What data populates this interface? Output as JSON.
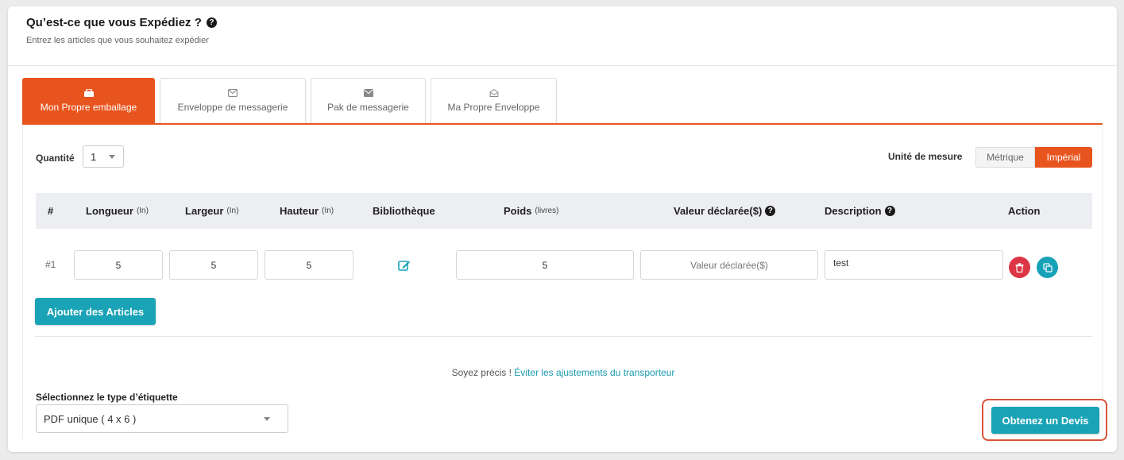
{
  "header": {
    "title": "Qu’est-ce que vous Expédiez ?",
    "subtitle": "Entrez les articles que vous souhaitez expédier"
  },
  "tabs": [
    {
      "label": "Mon Propre emballage",
      "icon": "package-icon",
      "active": true
    },
    {
      "label": "Enveloppe de messagerie",
      "icon": "envelope-outline-icon",
      "active": false
    },
    {
      "label": "Pak de messagerie",
      "icon": "envelope-solid-icon",
      "active": false
    },
    {
      "label": "Ma Propre Enveloppe",
      "icon": "envelope-open-icon",
      "active": false
    }
  ],
  "quantity": {
    "label": "Quantité",
    "value": "1"
  },
  "unit": {
    "label": "Unité de mesure",
    "metric": "Métrique",
    "imperial": "Impérial",
    "selected": "imperial"
  },
  "table": {
    "columns": {
      "num": "#",
      "length": "Longueur",
      "length_unit": "(In)",
      "width": "Largeur",
      "width_unit": "(In)",
      "height": "Hauteur",
      "height_unit": "(In)",
      "library": "Bibliothèque",
      "weight": "Poids",
      "weight_unit": "(livres)",
      "declared": "Valeur déclarée($)",
      "description": "Description",
      "action": "Action"
    },
    "rows": [
      {
        "num": "#1",
        "length": "5",
        "width": "5",
        "height": "5",
        "weight": "5",
        "declared_placeholder": "Valeur déclarée($)",
        "description": "test"
      }
    ]
  },
  "add_button": "Ajouter des Articles",
  "notice": {
    "text": "Soyez précis ! ",
    "link": "Éviter les ajustements du transporteur"
  },
  "label_type": {
    "label": "Sélectionnez le type d’étiquette",
    "value": "PDF unique ( 4 x 6 )"
  },
  "quote_button": "Obtenez un Devis",
  "colors": {
    "accent": "#e8541e",
    "teal": "#1aa3b6",
    "danger": "#dc3545"
  }
}
